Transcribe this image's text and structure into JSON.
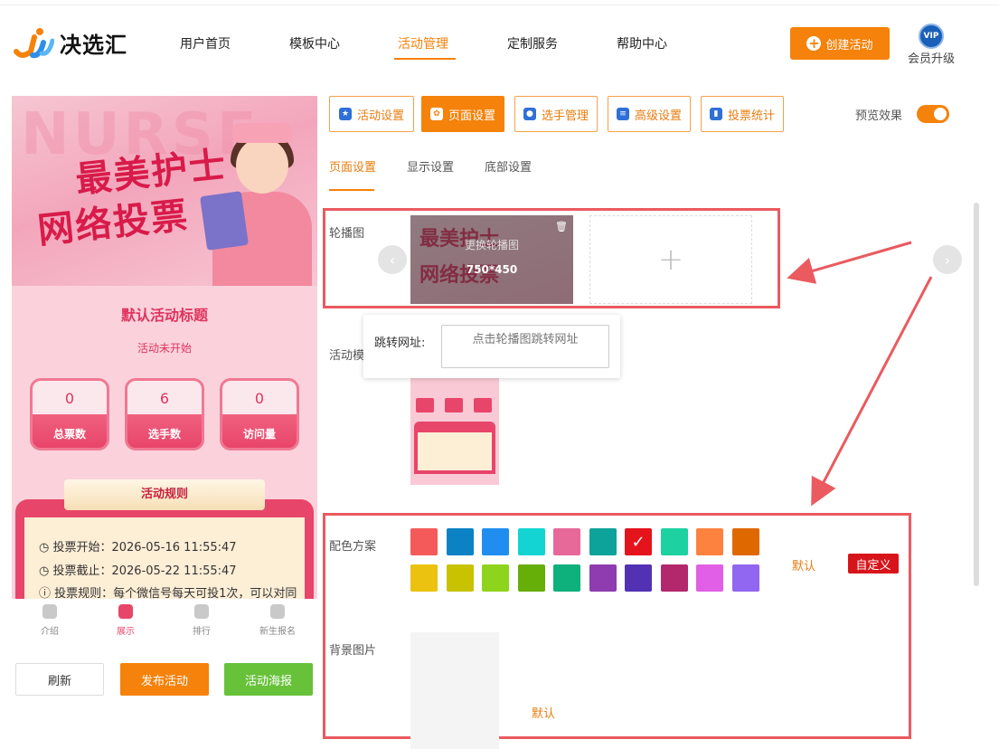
{
  "header": {
    "logo_text": "决选汇",
    "nav": [
      "用户首页",
      "模板中心",
      "活动管理",
      "定制服务",
      "帮助中心"
    ],
    "create_label": "创建活动",
    "vip_badge": "VIP",
    "vip_label": "会员升级"
  },
  "preview": {
    "banner_bg_text": "NURSE",
    "banner_title1": "最美护士",
    "banner_title2": "网络投票",
    "activity_title": "默认活动标题",
    "activity_status": "活动未开始",
    "stats": [
      {
        "value": "0",
        "label": "总票数"
      },
      {
        "value": "6",
        "label": "选手数"
      },
      {
        "value": "0",
        "label": "访问量"
      }
    ],
    "rules_title": "活动规则",
    "rules": [
      "投票开始：2026-05-16 11:55:47",
      "投票截止：2026-05-22 11:55:47",
      "投票规则：每个微信号每天可投1次，可以对同"
    ],
    "tabs": [
      "介绍",
      "展示",
      "排行",
      "新生报名"
    ],
    "buttons": {
      "refresh": "刷新",
      "publish": "发布活动",
      "poster": "活动海报"
    }
  },
  "toolbar": {
    "buttons": [
      "活动设置",
      "页面设置",
      "选手管理",
      "高级设置",
      "投票统计"
    ],
    "preview_label": "预览效果"
  },
  "subtabs": [
    "页面设置",
    "显示设置",
    "底部设置"
  ],
  "carousel": {
    "label": "轮播图",
    "replace_text": "更换轮播图",
    "size_text": "750*450",
    "add_symbol": "+",
    "link_label": "跳转网址:",
    "link_placeholder": "点击轮播图跳转网址"
  },
  "template_label": "活动模",
  "colors": {
    "label": "配色方案",
    "row1": [
      "#f45a5a",
      "#0b82c4",
      "#1f8ef0",
      "#13d4d2",
      "#e7699a",
      "#0ea39a",
      "#e5141c",
      "#1dd1a1",
      "#fd8240",
      "#e06800"
    ],
    "row2": [
      "#ebc20f",
      "#c8c200",
      "#8fd41c",
      "#66ae08",
      "#0eb07c",
      "#8e3cb0",
      "#5232b3",
      "#b3286c",
      "#e15fe4",
      "#9166f0"
    ],
    "selected_index": 6,
    "default_label": "默认",
    "custom_label": "自定义"
  },
  "background": {
    "label": "背景图片",
    "default_label": "默认"
  }
}
